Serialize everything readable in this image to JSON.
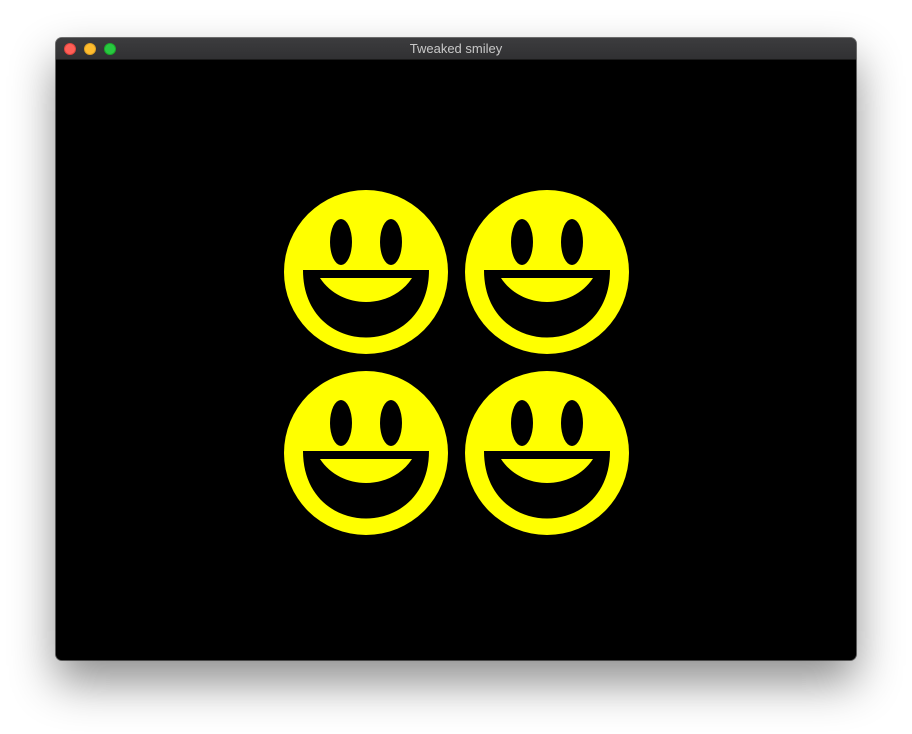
{
  "window": {
    "title": "Tweaked smiley"
  },
  "canvas": {
    "background": "#000000",
    "face_color": "#ffff00",
    "feature_color": "#000000",
    "smiley_count": 4
  }
}
